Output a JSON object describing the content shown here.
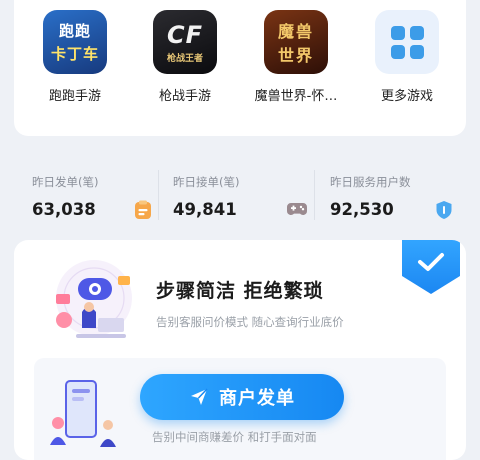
{
  "games": [
    {
      "label": "跑跑手游",
      "icon": "paopao-kart-icon",
      "icon_text": [
        "跑跑",
        "卡丁车"
      ]
    },
    {
      "label": "枪战手游",
      "icon": "crossfire-icon",
      "icon_text": [
        "CF",
        "枪战王者"
      ]
    },
    {
      "label": "魔兽世界-怀…",
      "icon": "warcraft-icon",
      "icon_text": [
        "魔兽",
        "世界"
      ]
    },
    {
      "label": "更多游戏",
      "icon": "more-games-grid-icon"
    }
  ],
  "stats": [
    {
      "label": "昨日发单(笔)",
      "value": "63,038",
      "icon": "clipboard-icon",
      "color": "#f6a74a"
    },
    {
      "label": "昨日接单(笔)",
      "value": "49,841",
      "icon": "gamepad-icon",
      "color": "#9a8a8f"
    },
    {
      "label": "昨日服务用户数",
      "value": "92,530",
      "icon": "shield-icon",
      "color": "#4aa8f0"
    }
  ],
  "promo": {
    "title": "步骤简洁 拒绝繁琐",
    "subtitle": "告别客服问价模式 随心查询行业底价",
    "button_label": "商户发单",
    "caption": "告别中间商赚差价 和打手面对面"
  },
  "colors": {
    "accent": "#1b8ef5",
    "background": "#eef1f6"
  }
}
